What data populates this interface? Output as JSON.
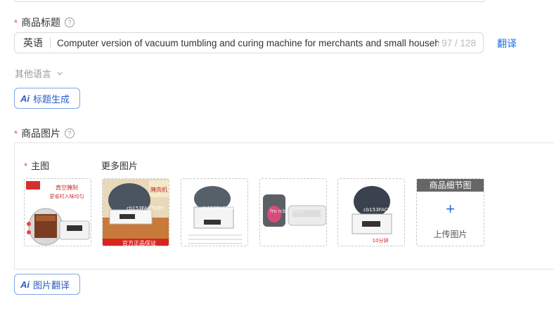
{
  "title_field": {
    "label": "商品标题",
    "required_mark": "*",
    "language": "英语",
    "value": "Computer version of vacuum tumbling and curing machine for merchants and small household use",
    "counter": "97 / 128",
    "translate_label": "翻译",
    "other_languages": "其他语言",
    "ai_button": "标题生成",
    "ai_icon_text": "Ai"
  },
  "images_field": {
    "label": "商品图片",
    "required_mark": "*",
    "main_label": "主图",
    "more_label": "更多图片",
    "detail_tag": "商品细节图",
    "upload_label": "上传图片",
    "ai_button": "图片翻译",
    "ai_icon_text": "Ai",
    "thumbnails": [
      {
        "caption_top": "真空腌制",
        "caption_mid": "更省时入味均匀",
        "overlay": ""
      },
      {
        "caption_top": "腌肉机",
        "caption_mid": "",
        "overlay": "cb153FACTORY",
        "banner": "官方正品保证"
      },
      {
        "caption_top": "",
        "caption_mid": "",
        "overlay": "cb153FACTORY"
      },
      {
        "caption_top": "",
        "caption_mid": "",
        "overlay": "fro rcb153FAC"
      },
      {
        "caption_top": "",
        "caption_mid": "",
        "overlay": "cb153FACTORY ST",
        "bottom": "10分钟"
      }
    ]
  },
  "colors": {
    "accent": "#1d6fe0",
    "required": "#e34d59",
    "border": "#d9d9d9"
  },
  "icons": [
    "help-circle-icon",
    "chevron-down-icon",
    "ai-icon",
    "plus-icon"
  ]
}
